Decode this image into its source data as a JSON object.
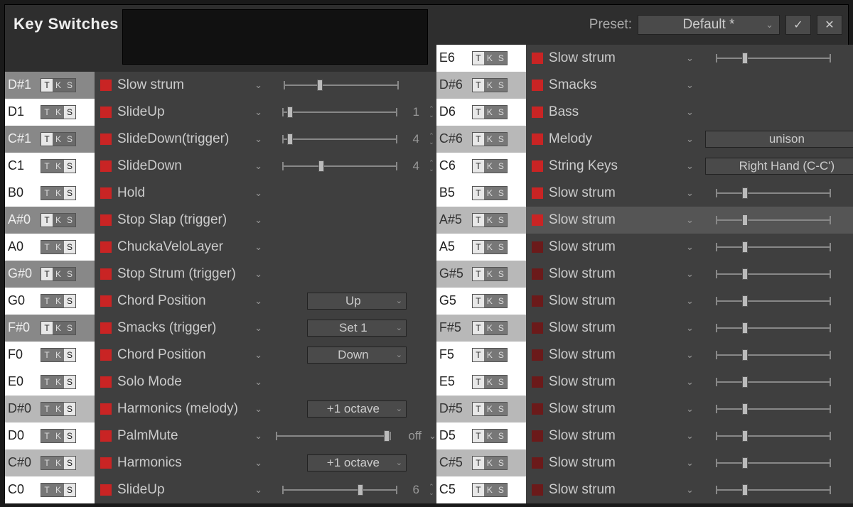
{
  "title": "Key Switches",
  "preset": {
    "label": "Preset:",
    "value": "Default *",
    "ok": "✓",
    "cancel": "✕"
  },
  "tks": [
    "T",
    "K",
    "S"
  ],
  "left": [
    {
      "key": "D#1",
      "shade": "grey",
      "tksSel": 0,
      "sq": "red",
      "art": "Slow strum",
      "ctrl": {
        "type": "slider",
        "pos": 30
      }
    },
    {
      "key": "D1",
      "shade": "white",
      "tksSel": 2,
      "sq": "red",
      "art": "SlideUp",
      "ctrl": {
        "type": "slider-num",
        "pos": 6,
        "num": "1"
      }
    },
    {
      "key": "C#1",
      "shade": "grey",
      "tksSel": 0,
      "sq": "red",
      "art": "SlideDown(trigger)",
      "ctrl": {
        "type": "slider-num",
        "pos": 6,
        "num": "4"
      }
    },
    {
      "key": "C1",
      "shade": "white",
      "tksSel": 2,
      "sq": "red",
      "art": "SlideDown",
      "ctrl": {
        "type": "slider-num",
        "pos": 32,
        "num": "4"
      }
    },
    {
      "key": "B0",
      "shade": "white",
      "tksSel": 2,
      "sq": "red",
      "art": "Hold",
      "ctrl": {
        "type": "none"
      }
    },
    {
      "key": "A#0",
      "shade": "grey",
      "tksSel": 0,
      "sq": "red",
      "art": "Stop Slap (trigger)",
      "ctrl": {
        "type": "none"
      }
    },
    {
      "key": "A0",
      "shade": "white",
      "tksSel": 2,
      "sq": "red",
      "art": "ChuckaVeloLayer",
      "ctrl": {
        "type": "none"
      }
    },
    {
      "key": "G#0",
      "shade": "grey",
      "tksSel": 0,
      "sq": "red",
      "art": "Stop Strum (trigger)",
      "ctrl": {
        "type": "none"
      }
    },
    {
      "key": "G0",
      "shade": "white",
      "tksSel": 2,
      "sq": "red",
      "art": "Chord Position",
      "ctrl": {
        "type": "drop",
        "val": "Up"
      }
    },
    {
      "key": "F#0",
      "shade": "grey",
      "tksSel": 0,
      "sq": "red",
      "art": "Smacks (trigger)",
      "ctrl": {
        "type": "drop",
        "val": "Set 1"
      }
    },
    {
      "key": "F0",
      "shade": "white",
      "tksSel": 2,
      "sq": "red",
      "art": "Chord Position",
      "ctrl": {
        "type": "drop",
        "val": "Down"
      }
    },
    {
      "key": "E0",
      "shade": "white",
      "tksSel": 2,
      "sq": "red",
      "art": "Solo Mode",
      "ctrl": {
        "type": "none"
      }
    },
    {
      "key": "D#0",
      "shade": "grey-lt",
      "tksSel": 2,
      "sq": "red",
      "art": "Harmonics (melody)",
      "ctrl": {
        "type": "drop",
        "val": "+1 octave"
      }
    },
    {
      "key": "D0",
      "shade": "white",
      "tksSel": 2,
      "sq": "red",
      "art": "PalmMute",
      "ctrl": {
        "type": "slider-off",
        "pos": 92,
        "val": "off"
      }
    },
    {
      "key": "C#0",
      "shade": "grey-lt",
      "tksSel": 2,
      "sq": "red",
      "art": "Harmonics",
      "ctrl": {
        "type": "drop",
        "val": "+1 octave"
      }
    },
    {
      "key": "C0",
      "shade": "white",
      "tksSel": 2,
      "sq": "red",
      "art": "SlideUp",
      "ctrl": {
        "type": "slider-num",
        "pos": 65,
        "num": "6"
      }
    }
  ],
  "right": [
    {
      "key": "E6",
      "shade": "white",
      "tksSel": 0,
      "sq": "red",
      "art": "Slow strum",
      "ctrl": {
        "type": "slider",
        "pos": 24
      }
    },
    {
      "key": "D#6",
      "shade": "grey-lt",
      "tksSel": 0,
      "sq": "red",
      "art": "Smacks",
      "ctrl": {
        "type": "none"
      }
    },
    {
      "key": "D6",
      "shade": "white",
      "tksSel": 0,
      "sq": "red",
      "art": "Bass",
      "ctrl": {
        "type": "none"
      }
    },
    {
      "key": "C#6",
      "shade": "grey-lt",
      "tksSel": 0,
      "sq": "red",
      "art": "Melody",
      "ctrl": {
        "type": "none"
      },
      "tail": {
        "type": "drop",
        "val": "unison"
      }
    },
    {
      "key": "C6",
      "shade": "white",
      "tksSel": 0,
      "sq": "red",
      "art": "String Keys",
      "ctrl": {
        "type": "none"
      },
      "tail": {
        "type": "drop",
        "val": "Right Hand (C-C')"
      }
    },
    {
      "key": "B5",
      "shade": "white",
      "tksSel": 0,
      "sq": "red",
      "art": "Slow strum",
      "ctrl": {
        "type": "slider",
        "pos": 24
      }
    },
    {
      "key": "A#5",
      "shade": "grey-lt",
      "tksSel": 0,
      "sq": "red",
      "art": "Slow strum",
      "ctrl": {
        "type": "slider",
        "pos": 24
      },
      "hl": true
    },
    {
      "key": "A5",
      "shade": "white",
      "tksSel": 0,
      "sq": "drk",
      "art": "Slow strum",
      "ctrl": {
        "type": "slider",
        "pos": 24
      }
    },
    {
      "key": "G#5",
      "shade": "grey-lt",
      "tksSel": 0,
      "sq": "drk",
      "art": "Slow strum",
      "ctrl": {
        "type": "slider",
        "pos": 24
      }
    },
    {
      "key": "G5",
      "shade": "white",
      "tksSel": 0,
      "sq": "drk",
      "art": "Slow strum",
      "ctrl": {
        "type": "slider",
        "pos": 24
      }
    },
    {
      "key": "F#5",
      "shade": "grey-lt",
      "tksSel": 0,
      "sq": "drk",
      "art": "Slow strum",
      "ctrl": {
        "type": "slider",
        "pos": 24
      }
    },
    {
      "key": "F5",
      "shade": "white",
      "tksSel": 0,
      "sq": "drk",
      "art": "Slow strum",
      "ctrl": {
        "type": "slider",
        "pos": 24
      }
    },
    {
      "key": "E5",
      "shade": "white",
      "tksSel": 0,
      "sq": "drk",
      "art": "Slow strum",
      "ctrl": {
        "type": "slider",
        "pos": 24
      }
    },
    {
      "key": "D#5",
      "shade": "grey-lt",
      "tksSel": 0,
      "sq": "drk",
      "art": "Slow strum",
      "ctrl": {
        "type": "slider",
        "pos": 24
      }
    },
    {
      "key": "D5",
      "shade": "white",
      "tksSel": 0,
      "sq": "drk",
      "art": "Slow strum",
      "ctrl": {
        "type": "slider",
        "pos": 24
      }
    },
    {
      "key": "C#5",
      "shade": "grey-lt",
      "tksSel": 0,
      "sq": "drk",
      "art": "Slow strum",
      "ctrl": {
        "type": "slider",
        "pos": 24
      }
    },
    {
      "key": "C5",
      "shade": "white",
      "tksSel": 0,
      "sq": "drk",
      "art": "Slow strum",
      "ctrl": {
        "type": "slider",
        "pos": 24
      }
    }
  ]
}
